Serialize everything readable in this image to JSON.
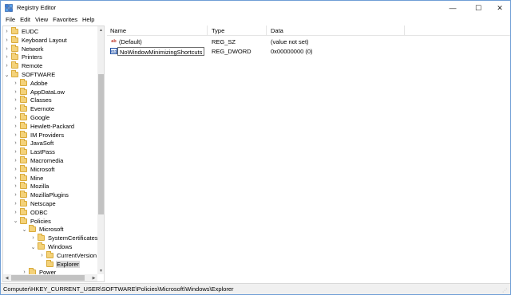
{
  "window": {
    "title": "Registry Editor",
    "controls": {
      "minimize": "—",
      "maximize": "☐",
      "close": "✕"
    }
  },
  "menu": [
    "File",
    "Edit",
    "View",
    "Favorites",
    "Help"
  ],
  "tree": [
    {
      "label": "EUDC",
      "expander": "›",
      "depth": 0
    },
    {
      "label": "Keyboard Layout",
      "expander": "›",
      "depth": 0
    },
    {
      "label": "Network",
      "expander": "›",
      "depth": 0
    },
    {
      "label": "Printers",
      "expander": "›",
      "depth": 0
    },
    {
      "label": "Remote",
      "expander": "›",
      "depth": 0
    },
    {
      "label": "SOFTWARE",
      "expander": "⌄",
      "depth": 0
    },
    {
      "label": "Adobe",
      "expander": "›",
      "depth": 1
    },
    {
      "label": "AppDataLow",
      "expander": "›",
      "depth": 1
    },
    {
      "label": "Classes",
      "expander": "›",
      "depth": 1
    },
    {
      "label": "Evernote",
      "expander": "›",
      "depth": 1
    },
    {
      "label": "Google",
      "expander": "›",
      "depth": 1
    },
    {
      "label": "Hewlett-Packard",
      "expander": "›",
      "depth": 1
    },
    {
      "label": "IM Providers",
      "expander": "›",
      "depth": 1
    },
    {
      "label": "JavaSoft",
      "expander": "›",
      "depth": 1
    },
    {
      "label": "LastPass",
      "expander": "›",
      "depth": 1
    },
    {
      "label": "Macromedia",
      "expander": "›",
      "depth": 1
    },
    {
      "label": "Microsoft",
      "expander": "›",
      "depth": 1
    },
    {
      "label": "Mine",
      "expander": "›",
      "depth": 1
    },
    {
      "label": "Mozilla",
      "expander": "›",
      "depth": 1
    },
    {
      "label": "MozillaPlugins",
      "expander": "›",
      "depth": 1
    },
    {
      "label": "Netscape",
      "expander": "›",
      "depth": 1
    },
    {
      "label": "ODBC",
      "expander": "›",
      "depth": 1
    },
    {
      "label": "Policies",
      "expander": "⌄",
      "depth": 1
    },
    {
      "label": "Microsoft",
      "expander": "⌄",
      "depth": 2
    },
    {
      "label": "SystemCertificates",
      "expander": "›",
      "depth": 3
    },
    {
      "label": "Windows",
      "expander": "⌄",
      "depth": 3
    },
    {
      "label": "CurrentVersion",
      "expander": "›",
      "depth": 4
    },
    {
      "label": "Explorer",
      "expander": "",
      "depth": 4,
      "selected": true
    },
    {
      "label": "Power",
      "expander": "›",
      "depth": 2
    }
  ],
  "values": {
    "columns": [
      "Name",
      "Type",
      "Data"
    ],
    "rows": [
      {
        "icon": "ab",
        "icon_name": "string-value-icon",
        "name": "(Default)",
        "type": "REG_SZ",
        "data": "(value not set)"
      },
      {
        "icon": "011",
        "icon_name": "dword-value-icon",
        "name": "NoWindowMinimizingShortcuts",
        "type": "REG_DWORD",
        "data": "0x00000000 (0)",
        "editing": true
      }
    ]
  },
  "statusbar": {
    "path": "Computer\\HKEY_CURRENT_USER\\SOFTWARE\\Policies\\Microsoft\\Windows\\Explorer"
  },
  "colors": {
    "window_border": "#6f9ed6",
    "folder": "#f4d27a",
    "selection": "#d9d9d9"
  }
}
